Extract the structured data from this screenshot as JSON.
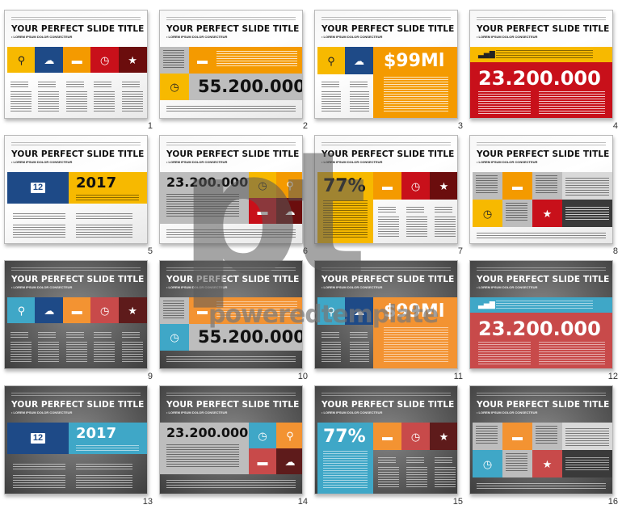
{
  "slide_title": "YOUR PERFECT SLIDE TITLE",
  "slide_subtitle": "• LOREM IPSUM DOLOR CONSECTEUR",
  "watermark": {
    "logo": "pt",
    "text": "poweredtemplate"
  },
  "colors": {
    "yellow": "#f7b900",
    "navy": "#1e4a87",
    "orange": "#f49a00",
    "red": "#c8101a",
    "maroon": "#6b0d0d",
    "teal": "#3fa7c7",
    "coral": "#c84a4a",
    "dark_maroon": "#5e1b1b",
    "soft_orange": "#f39332",
    "gray": "#bdbdbd",
    "charcoal": "#3a3a3a"
  },
  "slides": [
    {
      "number": "1",
      "theme": "light",
      "layout": "five-icons",
      "icons": [
        "search-icon",
        "cloud-icon",
        "folder-icon",
        "clock-icon",
        "star-icon"
      ]
    },
    {
      "number": "2",
      "theme": "light",
      "layout": "big-number-orange",
      "big_value": "55.200.000",
      "icons": [
        "folder-icon",
        "clock-icon"
      ]
    },
    {
      "number": "3",
      "theme": "light",
      "layout": "price",
      "big_value": "$99Ml",
      "icons": [
        "search-icon",
        "cloud-icon"
      ]
    },
    {
      "number": "4",
      "theme": "light",
      "layout": "banner-number",
      "big_value": "23.200.000",
      "icons": [
        "bar-chart-icon"
      ]
    },
    {
      "number": "5",
      "theme": "light",
      "layout": "year",
      "big_value": "2017",
      "calendar_day": "12",
      "icons": [
        "calendar-icon"
      ]
    },
    {
      "number": "6",
      "theme": "light",
      "layout": "number-grid",
      "big_value": "23.200.000",
      "icons": [
        "clock-icon",
        "search-icon",
        "folder-icon",
        "cloud-icon"
      ]
    },
    {
      "number": "7",
      "theme": "light",
      "layout": "percent",
      "big_value": "77%",
      "icons": [
        "folder-icon",
        "clock-icon",
        "star-icon"
      ]
    },
    {
      "number": "8",
      "theme": "light",
      "layout": "mosaic",
      "icons": [
        "folder-icon",
        "clock-icon",
        "star-icon"
      ]
    },
    {
      "number": "9",
      "theme": "dark",
      "layout": "five-icons",
      "icons": [
        "search-icon",
        "cloud-icon",
        "folder-icon",
        "clock-icon",
        "star-icon"
      ]
    },
    {
      "number": "10",
      "theme": "dark",
      "layout": "big-number-orange",
      "big_value": "55.200.000",
      "icons": [
        "folder-icon",
        "clock-icon"
      ]
    },
    {
      "number": "11",
      "theme": "dark",
      "layout": "price",
      "big_value": "$99Ml",
      "icons": [
        "search-icon",
        "cloud-icon"
      ]
    },
    {
      "number": "12",
      "theme": "dark",
      "layout": "banner-number",
      "big_value": "23.200.000",
      "icons": [
        "bar-chart-icon"
      ]
    },
    {
      "number": "13",
      "theme": "dark",
      "layout": "year",
      "big_value": "2017",
      "calendar_day": "12",
      "icons": [
        "calendar-icon"
      ]
    },
    {
      "number": "14",
      "theme": "dark",
      "layout": "number-grid",
      "big_value": "23.200.000",
      "icons": [
        "clock-icon",
        "search-icon",
        "folder-icon",
        "cloud-icon"
      ]
    },
    {
      "number": "15",
      "theme": "dark",
      "layout": "percent",
      "big_value": "77%",
      "icons": [
        "folder-icon",
        "clock-icon",
        "star-icon"
      ]
    },
    {
      "number": "16",
      "theme": "dark",
      "layout": "mosaic",
      "icons": [
        "folder-icon",
        "clock-icon",
        "star-icon"
      ]
    }
  ]
}
